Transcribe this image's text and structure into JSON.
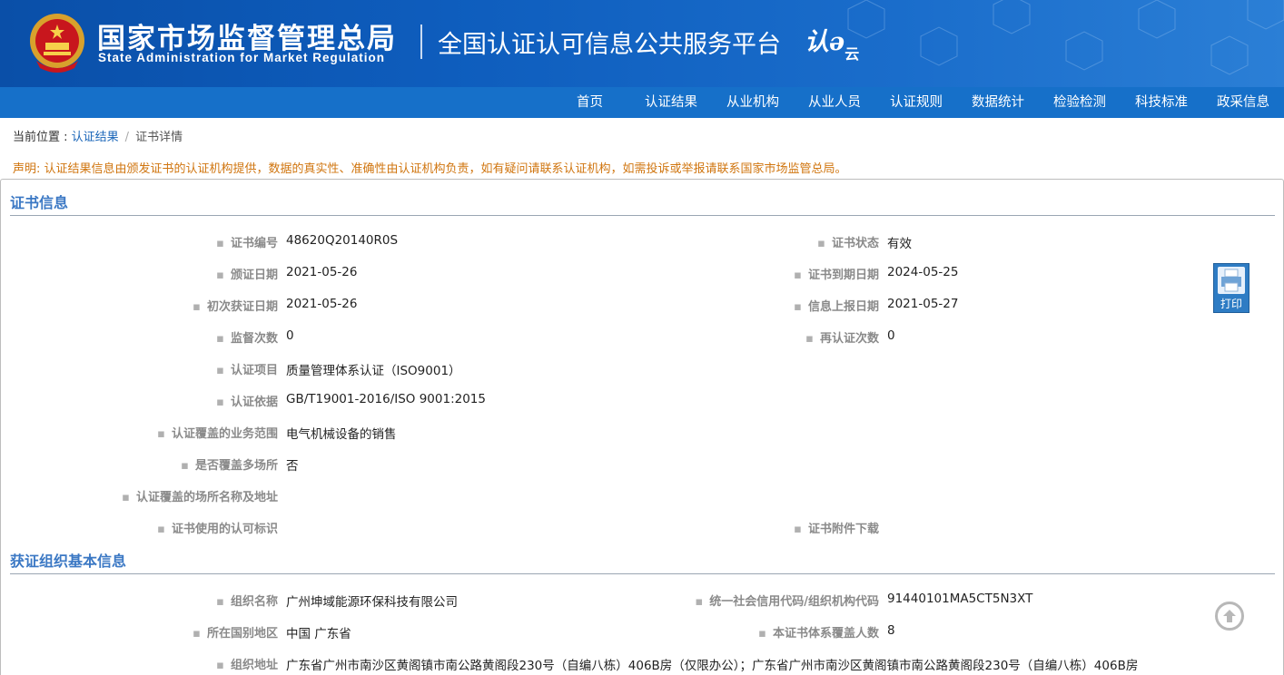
{
  "header": {
    "title_cn": "国家市场监督管理总局",
    "title_en": "State Administration  for  Market Regulation",
    "platform": "全国认证认可信息公共服务平台",
    "logo_text": "认",
    "logo_sub": "云"
  },
  "nav": [
    "首页",
    "认证结果",
    "从业机构",
    "从业人员",
    "认证规则",
    "数据统计",
    "检验检测",
    "科技标准",
    "政采信息"
  ],
  "breadcrumb": {
    "prefix": "当前位置 : ",
    "link": "认证结果",
    "separator": "/",
    "current": "证书详情"
  },
  "notice": "声明: 认证结果信息由颁发证书的认证机构提供，数据的真实性、准确性由认证机构负责，如有疑问请联系认证机构，如需投诉或举报请联系国家市场监管总局。",
  "cert_section": {
    "title": "证书信息",
    "left_fields": [
      {
        "label": "证书编号",
        "value": "48620Q20140R0S"
      },
      {
        "label": "颁证日期",
        "value": "2021-05-26"
      },
      {
        "label": "初次获证日期",
        "value": "2021-05-26"
      },
      {
        "label": "监督次数",
        "value": "0"
      },
      {
        "label": "认证项目",
        "value": "质量管理体系认证（ISO9001）"
      },
      {
        "label": "认证依据",
        "value": "GB/T19001-2016/ISO 9001:2015"
      },
      {
        "label": "认证覆盖的业务范围",
        "value": "电气机械设备的销售"
      },
      {
        "label": "是否覆盖多场所",
        "value": "否"
      },
      {
        "label": "认证覆盖的场所名称及地址",
        "value": ""
      },
      {
        "label": "证书使用的认可标识",
        "value": ""
      }
    ],
    "right_fields": [
      {
        "label": "证书状态",
        "value": "有效"
      },
      {
        "label": "证书到期日期",
        "value": "2024-05-25"
      },
      {
        "label": "信息上报日期",
        "value": "2021-05-27"
      },
      {
        "label": "再认证次数",
        "value": "0"
      },
      {
        "label": "证书附件下载",
        "value": ""
      }
    ]
  },
  "org_section": {
    "title": "获证组织基本信息",
    "fields": [
      {
        "label": "组织名称",
        "value": "广州坤域能源环保科技有限公司"
      },
      {
        "label": "统一社会信用代码/组织机构代码",
        "value": "91440101MA5CT5N3XT"
      },
      {
        "label": "所在国别地区",
        "value": "中国 广东省"
      },
      {
        "label": "本证书体系覆盖人数",
        "value": "8"
      },
      {
        "label": "组织地址",
        "value": "广东省广州市南沙区黄阁镇市南公路黄阁段230号（自编八栋）406B房（仅限办公）；广东省广州市南沙区黄阁镇市南公路黄阁段230号（自编八栋）406B房"
      }
    ]
  },
  "print_button": "打印",
  "icons": {
    "print": "printer-icon",
    "back_to_top": "arrow-up-circle-icon",
    "emblem": "national-emblem-icon"
  },
  "colors": {
    "banner": "#0e5dbd",
    "nav": "#1670c9",
    "section_title": "#3b78c4",
    "notice": "#d0750f",
    "link": "#1a66b9"
  }
}
